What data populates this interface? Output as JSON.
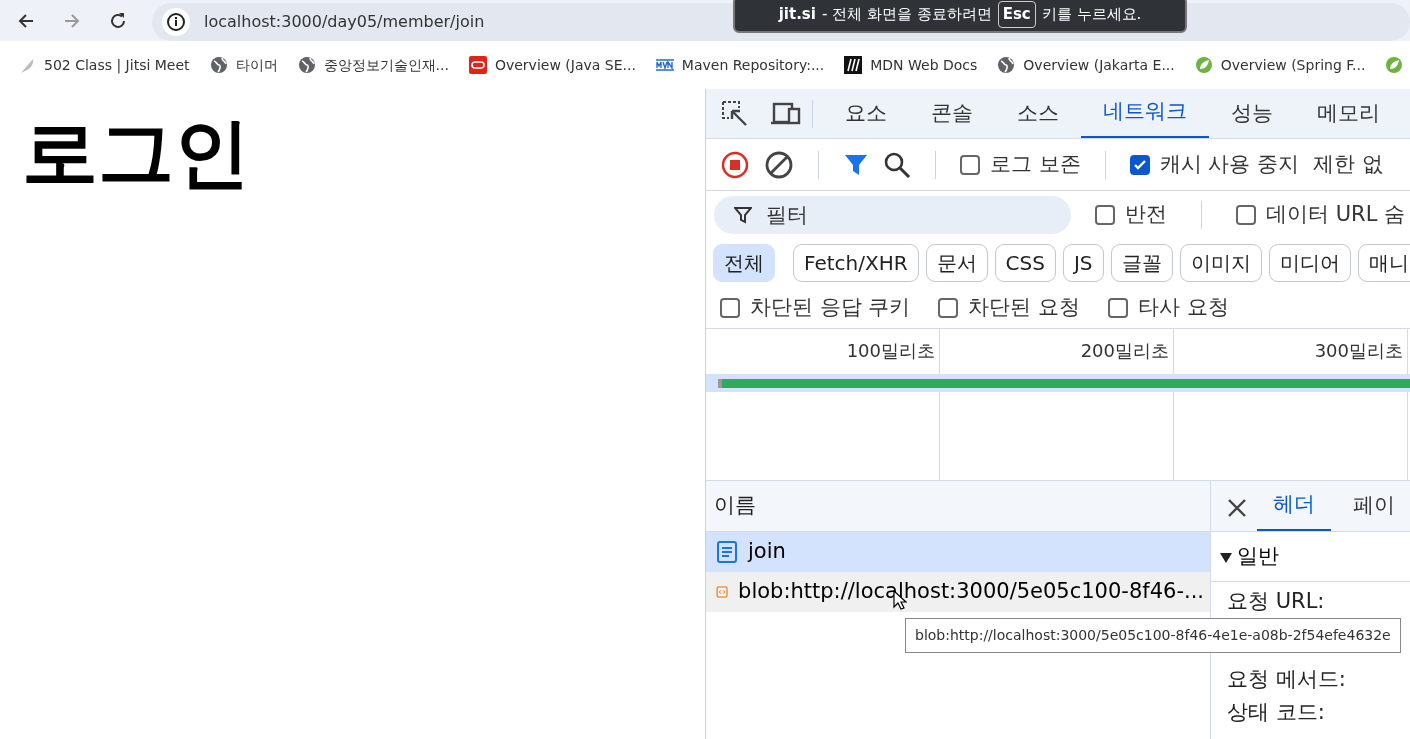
{
  "browser": {
    "address": "localhost:3000/day05/member/join"
  },
  "fullscreen_toast": {
    "site": "jit.si",
    "message_before": "- 전체 화면을 종료하려면",
    "key": "Esc",
    "message_after": "키를 누르세요."
  },
  "bookmarks": [
    {
      "label": "502 Class | Jitsi Meet",
      "kind": "feather"
    },
    {
      "label": "타이머",
      "kind": "globe"
    },
    {
      "label": "중앙정보기술인재...",
      "kind": "globe"
    },
    {
      "label": "Overview (Java SE...",
      "kind": "oracle"
    },
    {
      "label": "Maven Repository:...",
      "kind": "mvn"
    },
    {
      "label": "MDN Web Docs",
      "kind": "mdn"
    },
    {
      "label": "Overview (Jakarta E...",
      "kind": "globe"
    },
    {
      "label": "Overview (Spring F...",
      "kind": "spring"
    },
    {
      "kind": "spring"
    }
  ],
  "page": {
    "heading": "로그인"
  },
  "devtools": {
    "panel_tabs": [
      {
        "label": "요소",
        "selected": false
      },
      {
        "label": "콘솔",
        "selected": false
      },
      {
        "label": "소스",
        "selected": false
      },
      {
        "label": "네트워크",
        "selected": true
      },
      {
        "label": "성능",
        "selected": false
      },
      {
        "label": "메모리",
        "selected": false
      }
    ],
    "toolbar": {
      "recording": true,
      "checkboxes": [
        {
          "label": "로그 보존",
          "checked": false
        },
        {
          "label": "캐시 사용 중지",
          "checked": true
        }
      ],
      "throttling": "제한 없"
    },
    "filter": {
      "placeholder": "필터",
      "checkboxes": [
        {
          "label": "반전",
          "checked": false
        },
        {
          "label": "데이터 URL 숨",
          "checked": false
        }
      ]
    },
    "type_filters": [
      {
        "label": "전체",
        "selected": true
      },
      {
        "label": "Fetch/XHR",
        "selected": false
      },
      {
        "label": "문서",
        "selected": false
      },
      {
        "label": "CSS",
        "selected": false
      },
      {
        "label": "JS",
        "selected": false
      },
      {
        "label": "글꼴",
        "selected": false
      },
      {
        "label": "이미지",
        "selected": false
      },
      {
        "label": "미디어",
        "selected": false
      },
      {
        "label": "매니",
        "selected": false
      }
    ],
    "more_checkboxes": [
      {
        "label": "차단된 응답 쿠키",
        "checked": false
      },
      {
        "label": "차단된 요청",
        "checked": false
      },
      {
        "label": "타사 요청",
        "checked": false
      }
    ],
    "timeline": {
      "ticks": [
        "100밀리초",
        "200밀리초",
        "300밀리초"
      ]
    },
    "requests": {
      "column": "이름",
      "rows": [
        {
          "name": "join",
          "kind": "document",
          "selected": true,
          "hovered": false
        },
        {
          "name": "blob:http://localhost:3000/5e05c100-8f46-...",
          "kind": "script",
          "selected": false,
          "hovered": true
        }
      ]
    },
    "details": {
      "tabs": [
        {
          "label": "헤더",
          "selected": true
        },
        {
          "label": "페이",
          "selected": false
        }
      ],
      "section": "일반",
      "expanded": true,
      "fields": [
        "요청 URL:",
        "요청 메서드:",
        "상태 코드:"
      ]
    },
    "tooltip": "blob:http://localhost:3000/5e05c100-8f46-4e1e-a08b-2f54efe4632e"
  }
}
